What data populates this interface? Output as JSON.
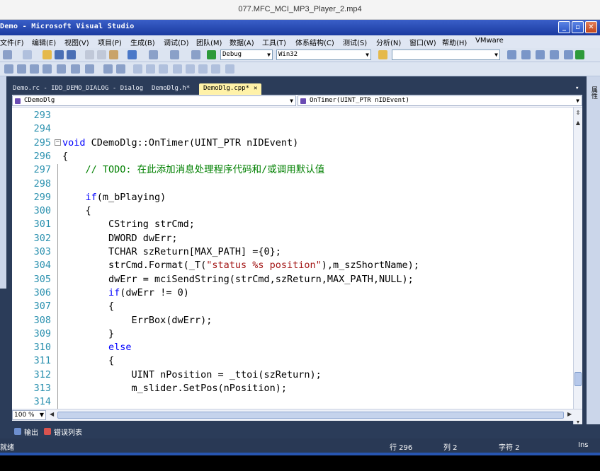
{
  "player": {
    "title": "077.MFC_MCI_MP3_Player_2.mp4"
  },
  "window": {
    "title": "Demo - Microsoft Visual Studio",
    "min": "_",
    "max": "▫",
    "close": "✕"
  },
  "menu": [
    "文件(F)",
    "编辑(E)",
    "视图(V)",
    "项目(P)",
    "生成(B)",
    "调试(D)",
    "团队(M)",
    "数据(A)",
    "工具(T)",
    "体系结构(C)",
    "测试(S)",
    "分析(N)",
    "窗口(W)",
    "帮助(H)",
    "VMware"
  ],
  "toolbar": {
    "config": "Debug",
    "platform": "Win32",
    "find": ""
  },
  "right_dock": {
    "label": "属性"
  },
  "doc_tabs": [
    {
      "label": "Demo.rc - IDD_DEMO_DIALOG - Dialog",
      "active": false
    },
    {
      "label": "DemoDlg.h*",
      "active": false
    },
    {
      "label": "DemoDlg.cpp*",
      "active": true
    }
  ],
  "doc_tab_close": "✕",
  "nav": {
    "class": "CDemoDlg",
    "member": "OnTimer(UINT_PTR nIDEvent)"
  },
  "editor": {
    "lines": [
      {
        "n": "293",
        "code": ""
      },
      {
        "n": "294",
        "code": ""
      },
      {
        "n": "295",
        "code": "void CDemoDlg::OnTimer(UINT_PTR nIDEvent)"
      },
      {
        "n": "296",
        "code": "{"
      },
      {
        "n": "297",
        "code": "    // TODO: 在此添加消息处理程序代码和/或调用默认值"
      },
      {
        "n": "298",
        "code": ""
      },
      {
        "n": "299",
        "code": "    if(m_bPlaying)"
      },
      {
        "n": "300",
        "code": "    {"
      },
      {
        "n": "301",
        "code": "        CString strCmd;"
      },
      {
        "n": "302",
        "code": "        DWORD dwErr;"
      },
      {
        "n": "303",
        "code": "        TCHAR szReturn[MAX_PATH] ={0};"
      },
      {
        "n": "304",
        "code": "        strCmd.Format(_T(\"status %s position\"),m_szShortName);"
      },
      {
        "n": "305",
        "code": "        dwErr = mciSendString(strCmd,szReturn,MAX_PATH,NULL);"
      },
      {
        "n": "306",
        "code": "        if(dwErr != 0)"
      },
      {
        "n": "307",
        "code": "        {"
      },
      {
        "n": "308",
        "code": "            ErrBox(dwErr);"
      },
      {
        "n": "309",
        "code": "        }"
      },
      {
        "n": "310",
        "code": "        else"
      },
      {
        "n": "311",
        "code": "        {"
      },
      {
        "n": "312",
        "code": "            UINT nPosition = _ttoi(szReturn);"
      },
      {
        "n": "313",
        "code": "            m_slider.SetPos(nPosition);"
      },
      {
        "n": "314",
        "code": ""
      }
    ]
  },
  "zoom": "100 %",
  "output_tabs": [
    {
      "label": "输出",
      "color": "#6d8fcf"
    },
    {
      "label": "错误列表",
      "color": "#d9534f"
    }
  ],
  "status": {
    "state": "就绪",
    "line": "行 296",
    "col": "列 2",
    "ch": "字符 2",
    "mode": "Ins"
  },
  "colors": {
    "keyword": "#0000ff",
    "comment": "#008000",
    "string": "#a31515",
    "line_number": "#2b91af",
    "active_tab": "#fff2a8"
  }
}
